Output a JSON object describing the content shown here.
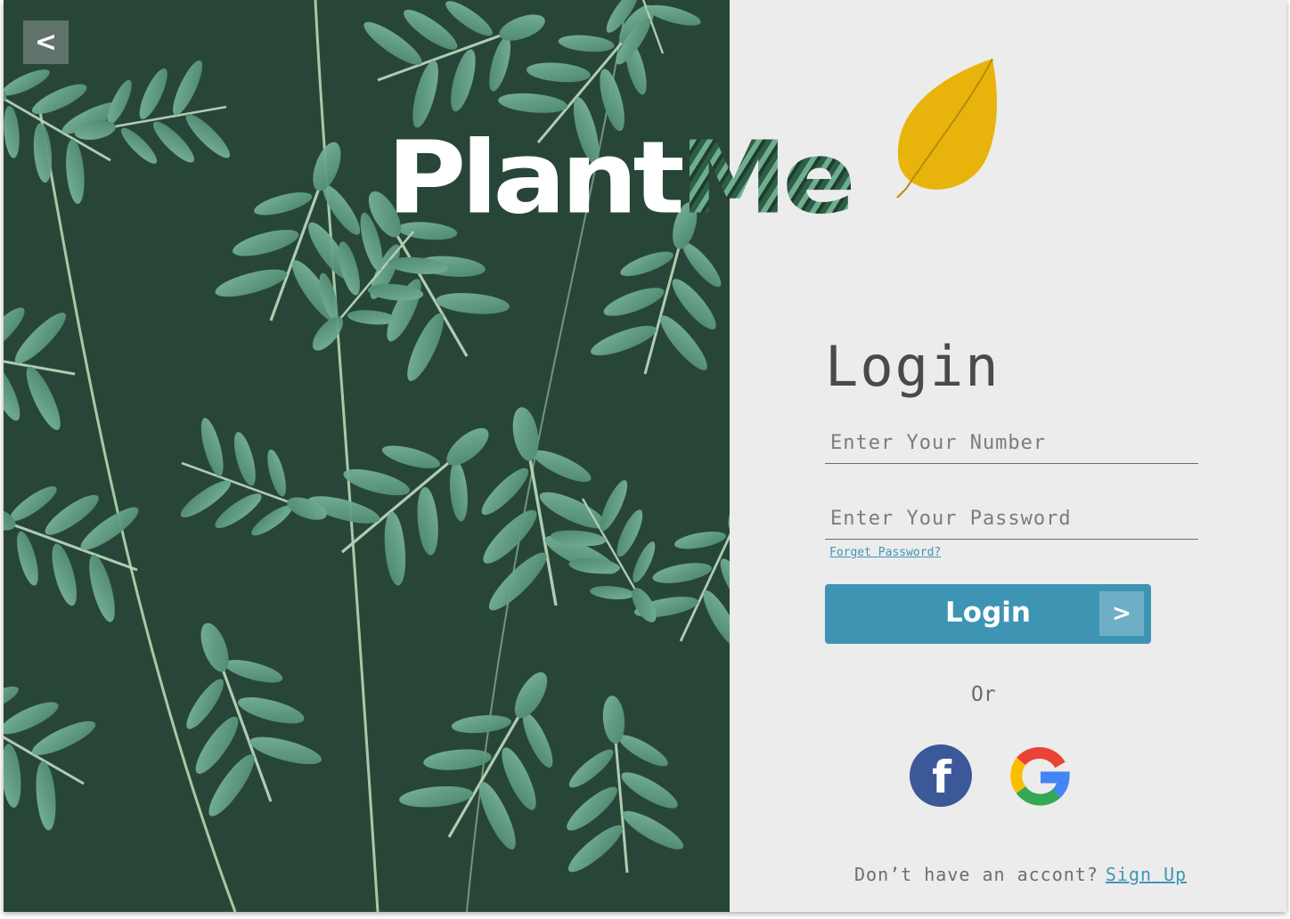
{
  "nav": {
    "back_label": "<"
  },
  "logo": {
    "part1": "Plant",
    "part2": "Me"
  },
  "form": {
    "title": "Login",
    "number_placeholder": "Enter Your Number",
    "password_placeholder": "Enter Your Password",
    "forgot_label": "Forget Password?",
    "login_label": "Login",
    "login_arrow": ">",
    "or_label": "Or"
  },
  "social": {
    "facebook_glyph": "f",
    "google_glyph": "G"
  },
  "footer": {
    "prompt": "Don’t have an accont?",
    "signup_label": "Sign Up"
  },
  "colors": {
    "accent": "#3e94b3",
    "background": "#ececec",
    "facebook": "#3b5998",
    "leaf": "#e8b40c"
  },
  "icons": [
    "back-arrow",
    "fern-photo",
    "leaf-icon",
    "facebook-icon",
    "google-icon",
    "arrow-right-icon"
  ]
}
